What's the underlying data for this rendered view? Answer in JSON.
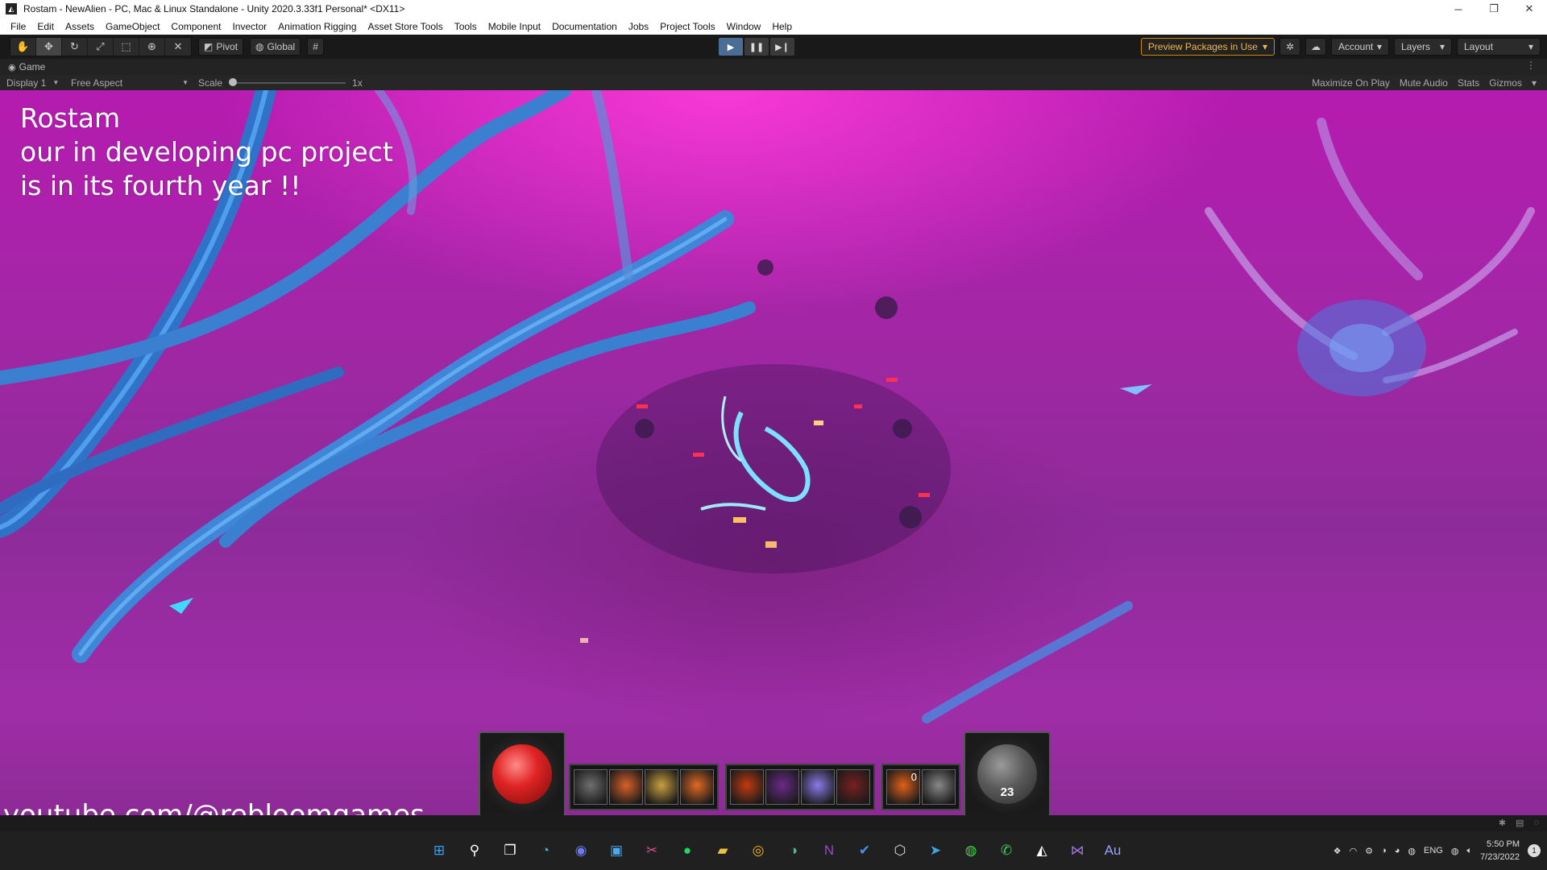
{
  "window": {
    "title": "Rostam - NewAlien - PC, Mac & Linux Standalone - Unity 2020.3.33f1 Personal* <DX11>",
    "minimize": "─",
    "restore": "❐",
    "close": "✕"
  },
  "menu": [
    "File",
    "Edit",
    "Assets",
    "GameObject",
    "Component",
    "Invector",
    "Animation Rigging",
    "Asset Store Tools",
    "Tools",
    "Mobile Input",
    "Documentation",
    "Jobs",
    "Project Tools",
    "Window",
    "Help"
  ],
  "toolbar": {
    "pivot_label": "Pivot",
    "global_label": "Global",
    "preview_packages": "Preview Packages in Use",
    "account": "Account",
    "layers": "Layers",
    "layout": "Layout"
  },
  "game_tab": {
    "label": "Game",
    "display": "Display 1",
    "aspect": "Free Aspect",
    "scale_label": "Scale",
    "scale_value": "1x",
    "maximize": "Maximize On Play",
    "mute": "Mute Audio",
    "stats": "Stats",
    "gizmos": "Gizmos"
  },
  "overlay": {
    "line1": "Rostam",
    "line2": "our in developing pc project",
    "line3": "is in its fourth year !!",
    "channel": "youtube.com/@rebloomgames"
  },
  "hud": {
    "skill_badge": "0",
    "mana_count": "23",
    "skills_left": [
      "#6f6f6f",
      "#d9602a",
      "#c9a040",
      "#e06a24"
    ],
    "skills_mid": [
      "#c23a10",
      "#6a2a8a",
      "#8a7ae8",
      "#7a2020"
    ],
    "skills_right": [
      "#e0601a",
      "#888888"
    ]
  },
  "taskbar": {
    "icons": [
      {
        "name": "windows-start-icon",
        "glyph": "⊞",
        "color": "#3aa0f0"
      },
      {
        "name": "search-icon",
        "glyph": "⚲",
        "color": "#ffffff"
      },
      {
        "name": "task-view-icon",
        "glyph": "❐",
        "color": "#ffffff"
      },
      {
        "name": "edge-icon",
        "glyph": "◔",
        "color": "#3ab0e8"
      },
      {
        "name": "discord-icon",
        "glyph": "◉",
        "color": "#6a7cf0"
      },
      {
        "name": "store-icon",
        "glyph": "▣",
        "color": "#4aa8f0"
      },
      {
        "name": "snipping-icon",
        "glyph": "✂",
        "color": "#e04a8a"
      },
      {
        "name": "spotify-icon",
        "glyph": "●",
        "color": "#1ed760"
      },
      {
        "name": "file-explorer-icon",
        "glyph": "▰",
        "color": "#f0c040"
      },
      {
        "name": "chrome-icon",
        "glyph": "◎",
        "color": "#f0b020"
      },
      {
        "name": "edge-dev-icon",
        "glyph": "◑",
        "color": "#40c090"
      },
      {
        "name": "onenote-icon",
        "glyph": "N",
        "color": "#9a4ad0"
      },
      {
        "name": "todo-icon",
        "glyph": "✔",
        "color": "#4a90f0"
      },
      {
        "name": "unity-hub-icon",
        "glyph": "⬡",
        "color": "#dddddd"
      },
      {
        "name": "telegram-icon",
        "glyph": "➤",
        "color": "#3aa8e0"
      },
      {
        "name": "browser-icon",
        "glyph": "◍",
        "color": "#40d040"
      },
      {
        "name": "whatsapp-icon",
        "glyph": "✆",
        "color": "#40d060"
      },
      {
        "name": "unity-icon",
        "glyph": "◭",
        "color": "#ffffff"
      },
      {
        "name": "visual-studio-icon",
        "glyph": "⋈",
        "color": "#a070e0"
      },
      {
        "name": "audition-icon",
        "glyph": "Au",
        "color": "#9aa0ff"
      }
    ],
    "language": "ENG",
    "time": "5:50 PM",
    "date": "7/23/2022",
    "notifications": "1"
  }
}
